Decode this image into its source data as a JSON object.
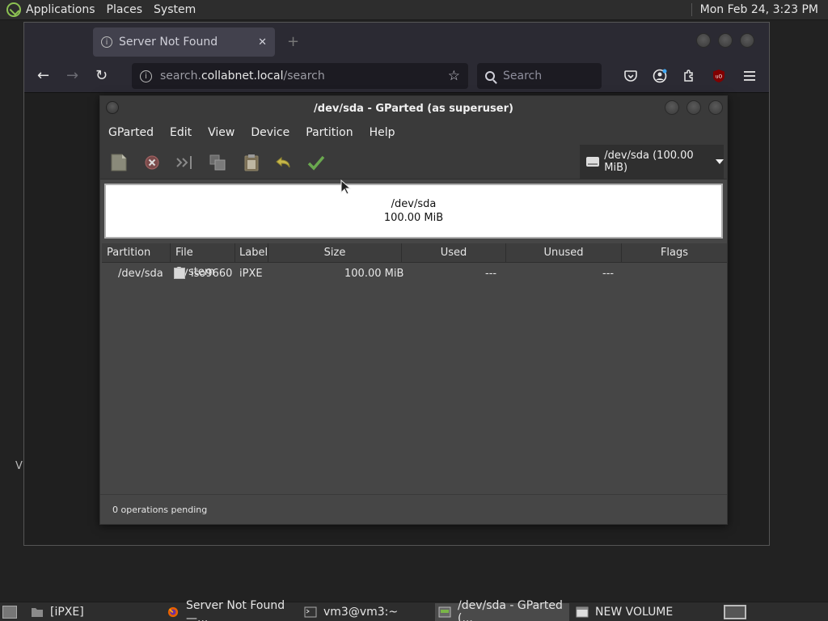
{
  "top_panel": {
    "menus": [
      "Applications",
      "Places",
      "System"
    ],
    "clock": "Mon Feb 24,  3:23 PM"
  },
  "browser": {
    "tab_title": "Server Not Found",
    "url_prefix": "search.",
    "url_domain": "collabnet.local",
    "url_path": "/search",
    "search_placeholder": "Search"
  },
  "stray_text": "V",
  "gparted": {
    "title": "/dev/sda - GParted (as superuser)",
    "menus": [
      "GParted",
      "Edit",
      "View",
      "Device",
      "Partition",
      "Help"
    ],
    "device_selector": "/dev/sda (100.00 MiB)",
    "disk_map": {
      "name": "/dev/sda",
      "size": "100.00 MiB"
    },
    "table": {
      "headers": [
        "Partition",
        "File System",
        "Label",
        "Size",
        "Used",
        "Unused",
        "Flags"
      ],
      "rows": [
        {
          "partition": "/dev/sda",
          "filesystem": "iso9660",
          "label": "iPXE",
          "size": "100.00 MiB",
          "used": "---",
          "unused": "---",
          "flags": ""
        }
      ]
    },
    "status": "0 operations pending"
  },
  "taskbar": {
    "items": [
      "[iPXE]",
      "Server Not Found —...",
      "vm3@vm3:~",
      "/dev/sda - GParted (...",
      "NEW VOLUME"
    ]
  },
  "colors": {
    "apply_green": "#6aa84f",
    "undo_yellow": "#c8b84a",
    "delete_red": "#d9534f",
    "ublock_red": "#800000"
  }
}
